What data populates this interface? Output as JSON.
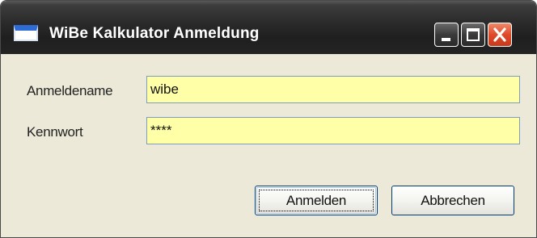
{
  "window": {
    "title": "WiBe Kalkulator Anmeldung",
    "icon": "window-app-icon",
    "controls": [
      "minimize-icon",
      "maximize-icon",
      "close-icon"
    ],
    "close_color": "#de4b2a"
  },
  "form": {
    "username_label": "Anmeldename",
    "username_value": "wibe",
    "password_label": "Kennwort",
    "password_value": "****",
    "field_background": "#ffffa8"
  },
  "buttons": {
    "login_label": "Anmelden",
    "cancel_label": "Abbrechen"
  }
}
